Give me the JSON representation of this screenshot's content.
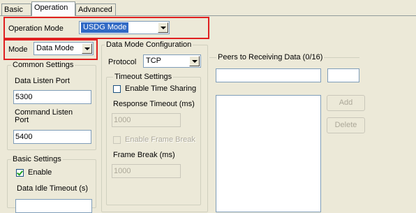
{
  "tabs": [
    {
      "label": "Basic"
    },
    {
      "label": "Operation"
    },
    {
      "label": "Advanced"
    }
  ],
  "operation_mode": {
    "label": "Operation Mode",
    "value": "USDG Mode"
  },
  "mode": {
    "label": "Mode",
    "value": "Data Mode"
  },
  "common_settings": {
    "title": "Common Settings",
    "data_listen_port_label": "Data Listen Port",
    "data_listen_port": "5300",
    "command_listen_port_label_1": "Command Listen",
    "command_listen_port_label_2": "Port",
    "command_listen_port": "5400"
  },
  "basic_settings": {
    "title": "Basic Settings",
    "enable_label": "Enable",
    "enable_checked": true,
    "idle_timeout_label": "Data Idle Timeout (s)"
  },
  "data_mode_config": {
    "title": "Data Mode Configuration",
    "protocol_label": "Protocol",
    "protocol_value": "TCP",
    "timeout_settings": {
      "title": "Timeout Settings",
      "enable_time_sharing_label": "Enable Time Sharing",
      "enable_time_sharing_checked": false,
      "response_timeout_label": "Response Timeout (ms)",
      "response_timeout_value": "1000",
      "enable_frame_break_label": "Enable Frame Break",
      "enable_frame_break_checked": false,
      "frame_break_label": "Frame Break (ms)",
      "frame_break_value": "1000"
    }
  },
  "peers": {
    "title": "Peers to Receiving Data (0/16)",
    "add_label": "Add",
    "delete_label": "Delete"
  },
  "colors": {
    "highlight_box": "#E02020",
    "selection": "#316AC5",
    "panel": "#ECE9D8"
  }
}
